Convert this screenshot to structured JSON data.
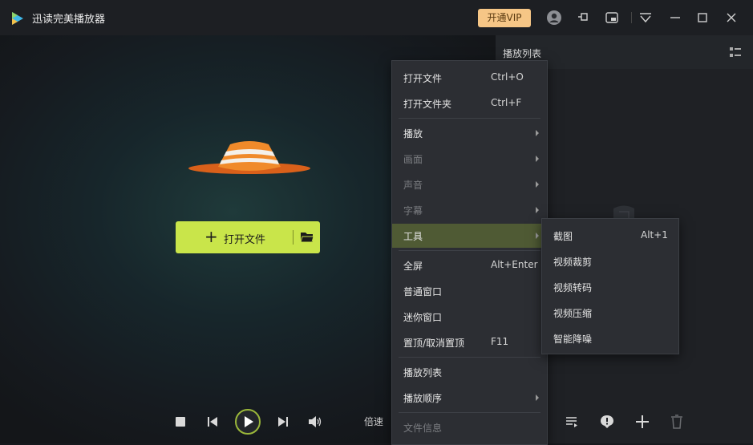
{
  "app": {
    "title": "迅读完美播放器",
    "vip_label": "开通VIP",
    "accent": "#c9e54a",
    "vip_color": "#f6c686"
  },
  "titlebar_icons": [
    "user-avatar-icon",
    "pin-icon",
    "mini-mode-icon",
    "dropdown-icon",
    "minimize-icon",
    "maximize-icon",
    "close-icon"
  ],
  "player": {
    "open_file_label": "打开文件",
    "speed_label": "倍速"
  },
  "playlist": {
    "title": "播放列表"
  },
  "context_menu": {
    "open_file": {
      "label": "打开文件",
      "shortcut": "Ctrl+O"
    },
    "open_folder": {
      "label": "打开文件夹",
      "shortcut": "Ctrl+F"
    },
    "play": {
      "label": "播放"
    },
    "picture": {
      "label": "画面"
    },
    "sound": {
      "label": "声音"
    },
    "subtitle": {
      "label": "字幕"
    },
    "tools": {
      "label": "工具"
    },
    "fullscreen": {
      "label": "全屏",
      "shortcut": "Alt+Enter"
    },
    "normal_window": {
      "label": "普通窗口"
    },
    "mini_window": {
      "label": "迷你窗口"
    },
    "pin_top": {
      "label": "置顶/取消置顶",
      "shortcut": "F11"
    },
    "playlist": {
      "label": "播放列表"
    },
    "play_order": {
      "label": "播放顺序"
    },
    "file_info": {
      "label": "文件信息"
    }
  },
  "tools_submenu": {
    "screenshot": {
      "label": "截图",
      "shortcut": "Alt+1"
    },
    "video_clip": {
      "label": "视频裁剪"
    },
    "video_convert": {
      "label": "视频转码"
    },
    "video_compress": {
      "label": "视频压缩"
    },
    "noise_reduction": {
      "label": "智能降噪"
    }
  }
}
